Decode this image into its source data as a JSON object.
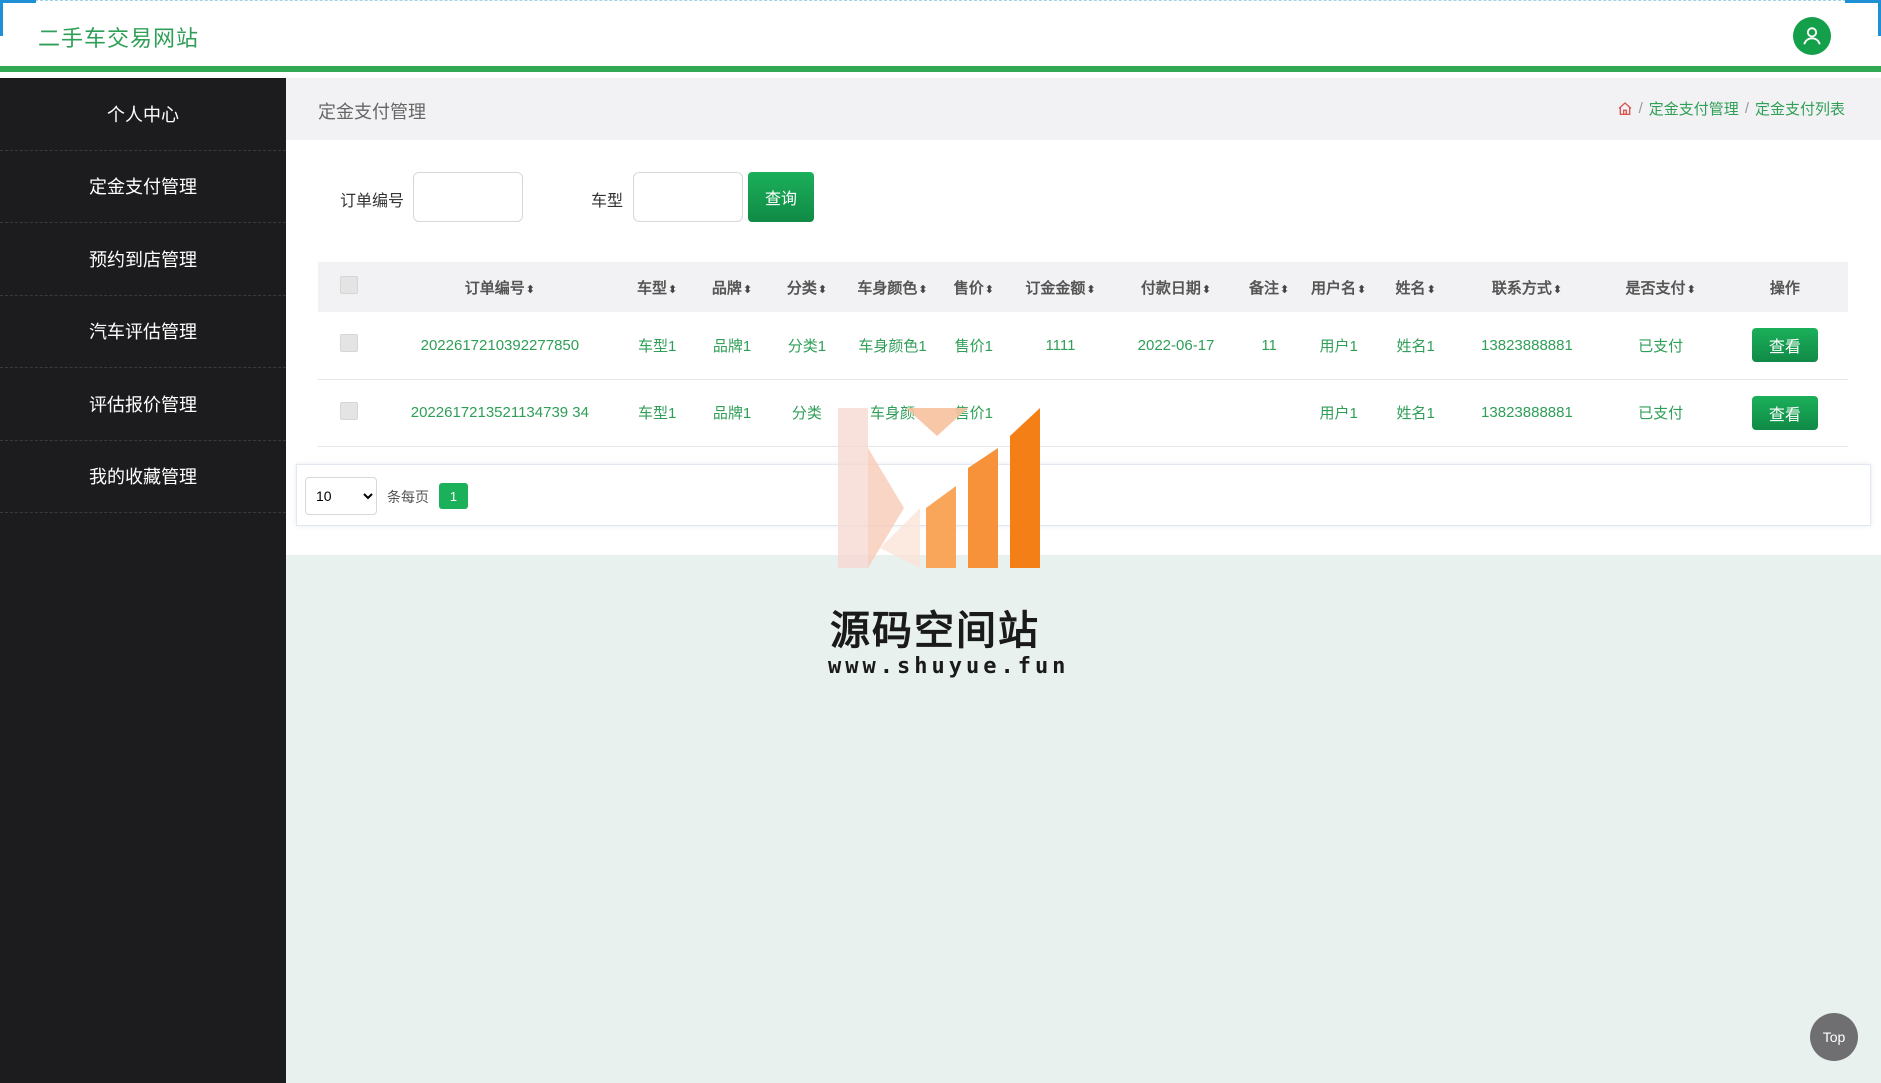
{
  "header": {
    "title": "二手车交易网站",
    "user_icon": "user-icon"
  },
  "sidebar": {
    "items": [
      {
        "label": "个人中心"
      },
      {
        "label": "定金支付管理"
      },
      {
        "label": "预约到店管理"
      },
      {
        "label": "汽车评估管理"
      },
      {
        "label": "评估报价管理"
      },
      {
        "label": "我的收藏管理"
      }
    ]
  },
  "page": {
    "title": "定金支付管理",
    "breadcrumb": {
      "separator": "/",
      "items": [
        "定金支付管理",
        "定金支付列表"
      ]
    }
  },
  "search": {
    "order_label": "订单编号",
    "order_value": "",
    "model_label": "车型",
    "model_value": "",
    "query_button": "查询"
  },
  "table": {
    "sort_glyph": "⬍",
    "headers": [
      "订单编号",
      "车型",
      "品牌",
      "分类",
      "车身颜色",
      "售价",
      "订金金额",
      "付款日期",
      "备注",
      "用户名",
      "姓名",
      "联系方式",
      "是否支付",
      "操作"
    ],
    "rows": [
      {
        "order_no": "2022617210392277850",
        "model": "车型1",
        "brand": "品牌1",
        "category": "分类1",
        "color": "车身颜色1",
        "price": "售价1",
        "deposit": "1111",
        "date": "2022-06-17",
        "note": "11",
        "username": "用户1",
        "name": "姓名1",
        "phone": "13823888881",
        "paid": "已支付",
        "action": "查看"
      },
      {
        "order_no": "2022617213521134739 34",
        "model": "车型1",
        "brand": "品牌1",
        "category": "分类",
        "color": "车身颜",
        "price": "售价1",
        "deposit": "",
        "date": "",
        "note": "",
        "username": "用户1",
        "name": "姓名1",
        "phone": "13823888881",
        "paid": "已支付",
        "action": "查看"
      }
    ]
  },
  "pager": {
    "page_size": "10",
    "page_size_options": [
      "10"
    ],
    "per_page_label": "条每页",
    "current_page": "1"
  },
  "watermark": {
    "title": "源码空间站",
    "url": "www.shuyue.fun"
  },
  "top_button": "Top",
  "colors": {
    "accent": "#2f9e57",
    "button": "#14a04a",
    "sidebar": "#1c1c1e"
  }
}
